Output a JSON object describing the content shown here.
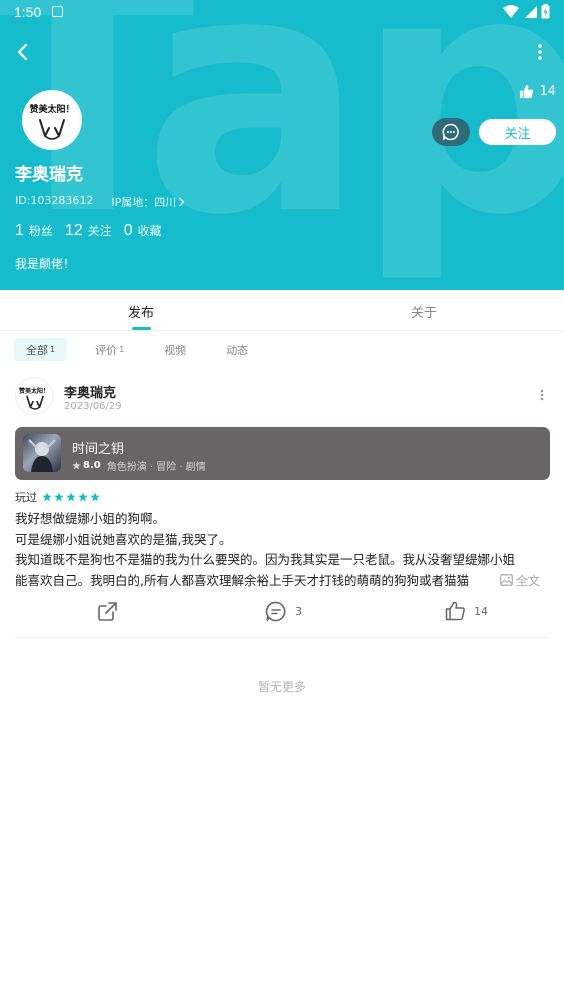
{
  "statusbar": {
    "time": "1:50"
  },
  "header": {
    "likes_count": "14",
    "follow_label": "关注",
    "username": "李奥瑞克",
    "user_id": "ID:103283612",
    "ip_location": "IP属地：四川",
    "avatar_text": "赞美太阳！",
    "bio": "我是颠佬！",
    "watermark_text": "TapTap",
    "background_color": "#16bccb"
  },
  "stats": [
    {
      "num": "1",
      "label": "粉丝"
    },
    {
      "num": "12",
      "label": "关注"
    },
    {
      "num": "0",
      "label": "收藏"
    }
  ],
  "tabs": {
    "publish": "发布",
    "about": "关于"
  },
  "filters": [
    {
      "label": "全部",
      "count": "1"
    },
    {
      "label": "评价",
      "count": "1"
    },
    {
      "label": "视频",
      "count": ""
    },
    {
      "label": "动态",
      "count": ""
    }
  ],
  "post": {
    "author": "李奥瑞克",
    "date": "2023/06/29",
    "avatar_text": "赞美太阳！",
    "game": {
      "title": "时间之钥",
      "score": "8.0",
      "tags": "角色扮演 · 冒险 · 剧情"
    },
    "played_label": "玩过",
    "rating": 5,
    "lines": [
      "我好想做缇娜小姐的狗啊。",
      "可是缇娜小姐说她喜欢的是猫,我哭了。",
      "我知道既不是狗也不是猫的我为什么要哭的。因为我其实是一只老鼠。我从没奢望缇娜小姐",
      "能喜欢自己。我明白的,所有人都喜欢理解余裕上手天才打钱的萌萌的狗狗或者猫猫"
    ],
    "fulltext_label": "全文",
    "comments_count": "3",
    "likes_count": "14"
  },
  "footer": {
    "no_more": "暂无更多"
  }
}
